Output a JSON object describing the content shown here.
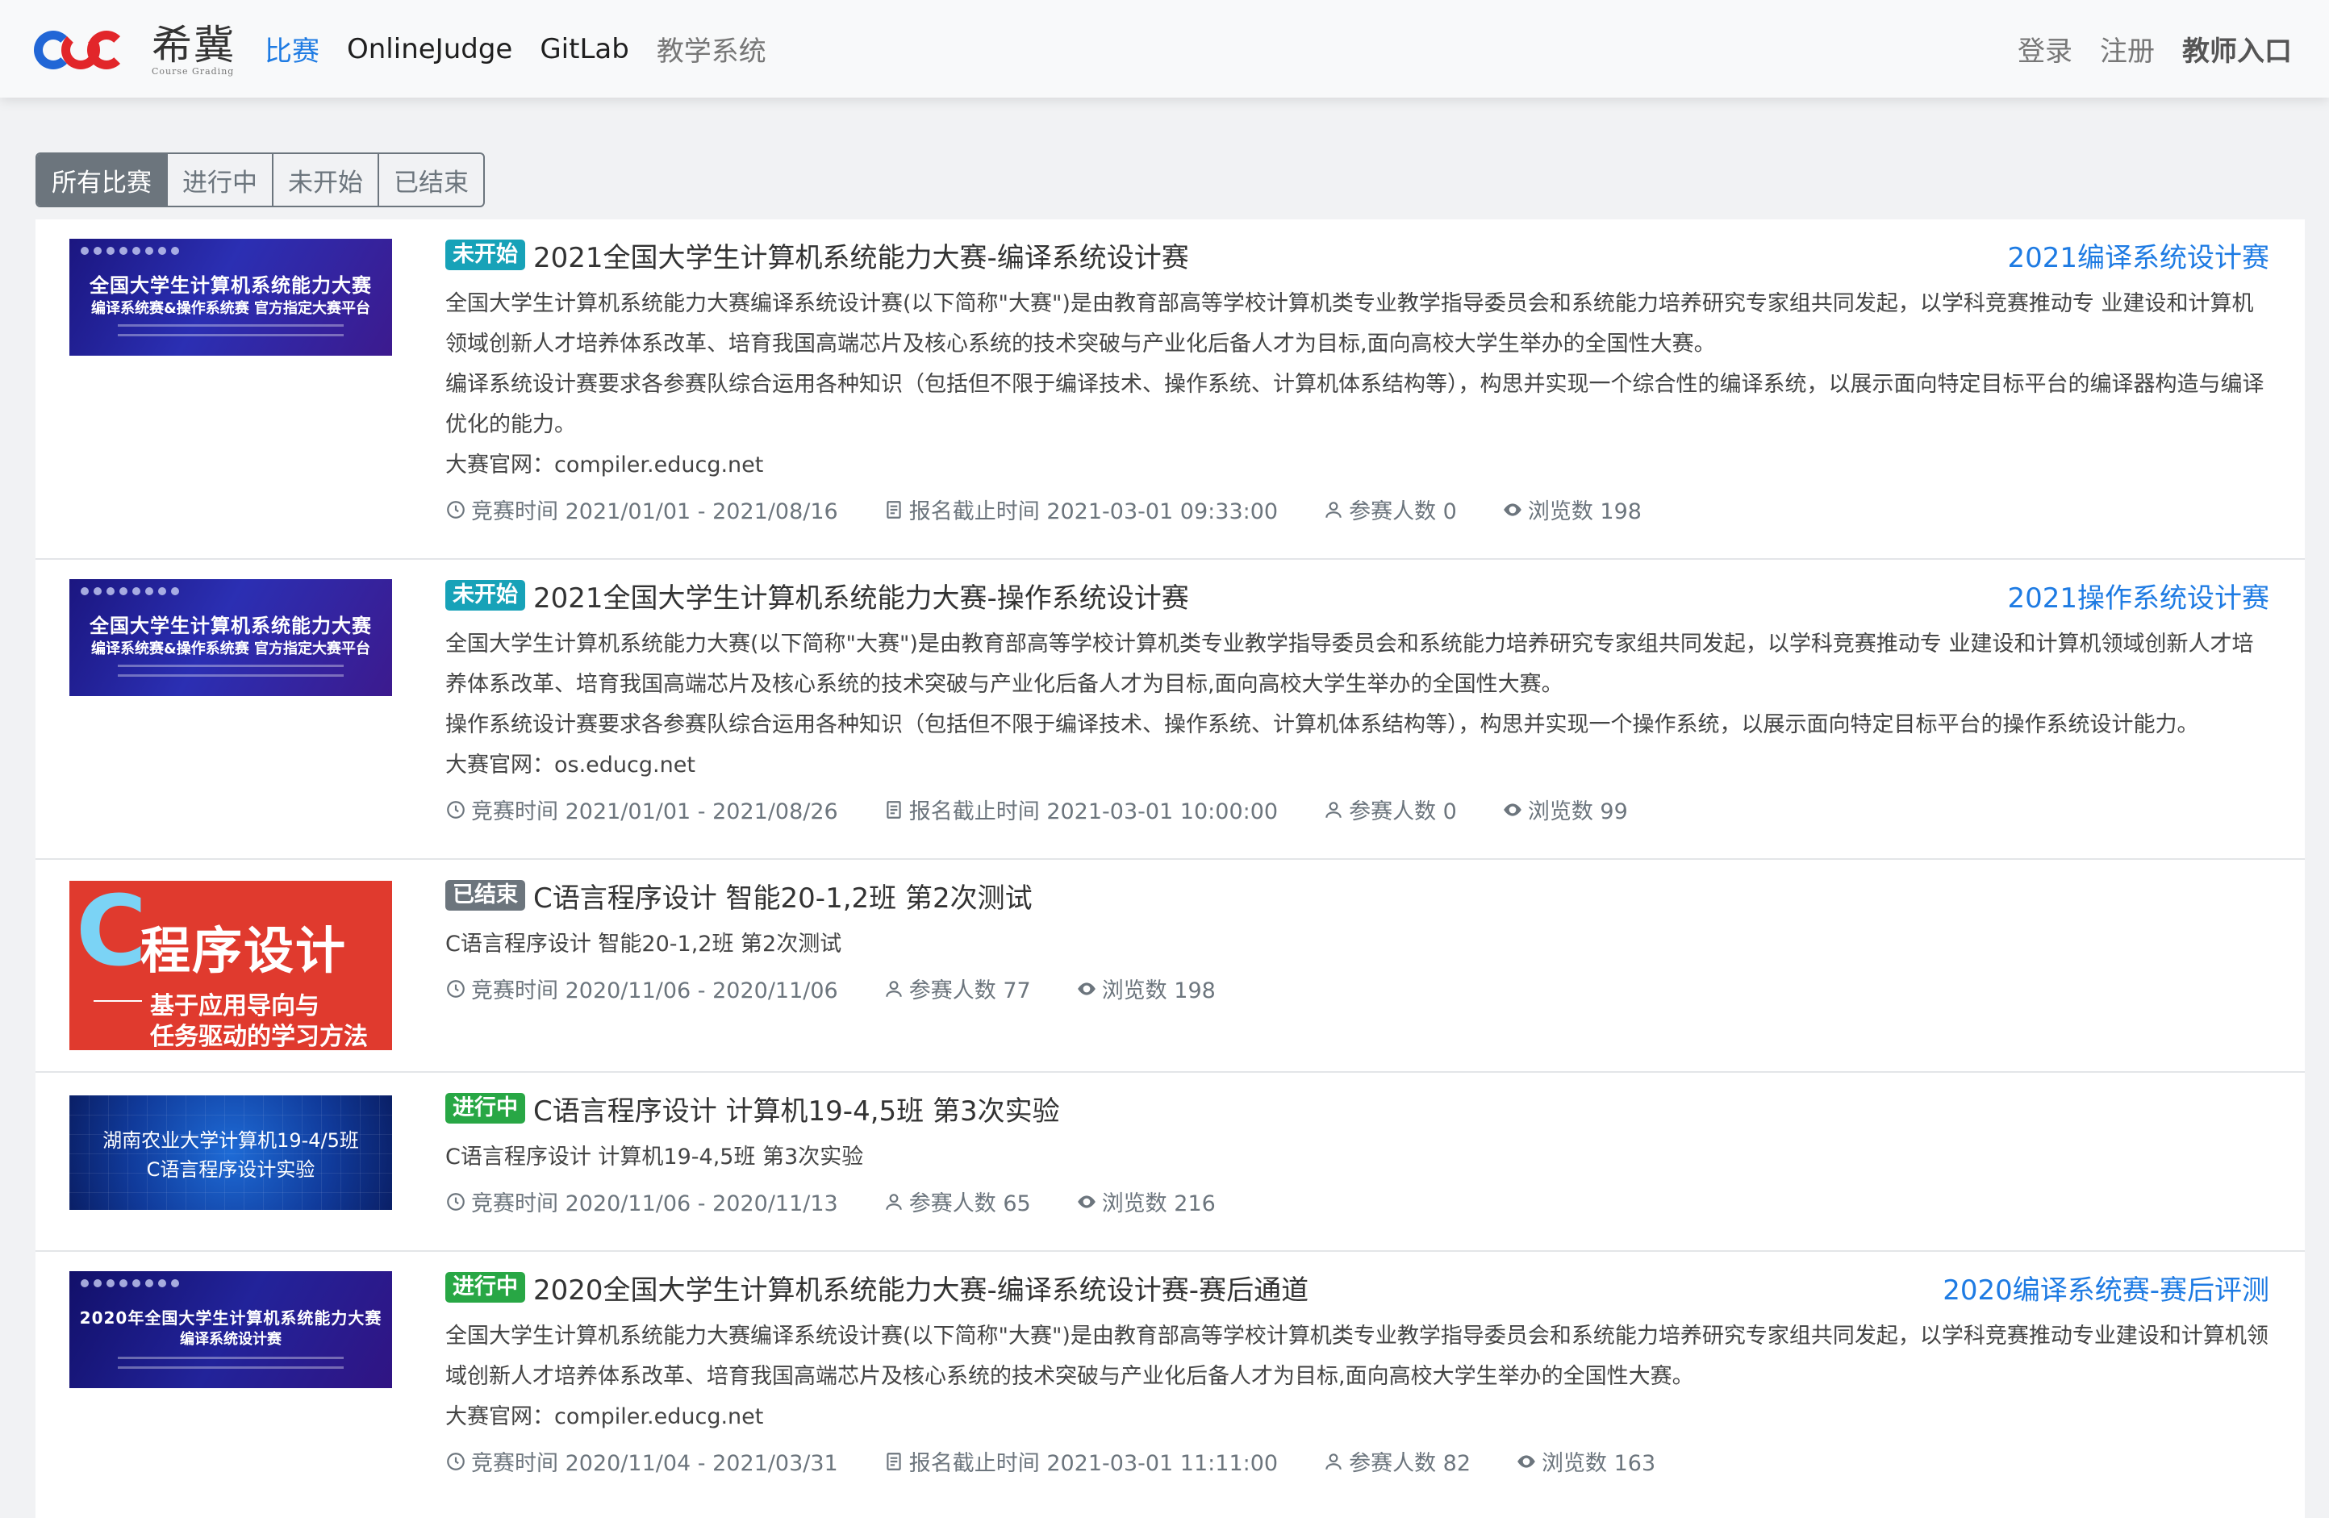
{
  "brand": {
    "name": "希冀",
    "sub": "Course Grading"
  },
  "nav": {
    "left": [
      {
        "label": "比赛",
        "state": "active"
      },
      {
        "label": "OnlineJudge",
        "state": "normal"
      },
      {
        "label": "GitLab",
        "state": "normal"
      },
      {
        "label": "教学系统",
        "state": "muted"
      }
    ],
    "right": [
      {
        "label": "登录"
      },
      {
        "label": "注册"
      },
      {
        "label": "教师入口"
      }
    ]
  },
  "filters": [
    "所有比赛",
    "进行中",
    "未开始",
    "已结束"
  ],
  "filter_active": "所有比赛",
  "colors": {
    "link": "#1e7be3",
    "upcoming": "#17a2b8",
    "running": "#28a745",
    "ended": "#6c757d"
  },
  "contests": [
    {
      "status": "未开始",
      "title": "2021全国大学生计算机系统能力大赛-编译系统设计赛",
      "side_link": "2021编译系统设计赛",
      "thumb": {
        "line1": "全国大学生计算机系统能力大赛",
        "line2": "编译系统赛&操作系统赛 官方指定大赛平台"
      },
      "desc": [
        "全国大学生计算机系统能力大赛编译系统设计赛(以下简称\"大赛\")是由教育部高等学校计算机类专业教学指导委员会和系统能力培养研究专家组共同发起，以学科竞赛推动专 业建设和计算机领域创新人才培养体系改革、培育我国高端芯片及核心系统的技术突破与产业化后备人才为目标,面向高校大学生举办的全国性大赛。",
        "编译系统设计赛要求各参赛队综合运用各种知识（包括但不限于编译技术、操作系统、计算机体系结构等），构思并实现一个综合性的编译系统，以展示面向特定目标平台的编译器构造与编译优化的能力。",
        "大赛官网：compiler.educg.net"
      ],
      "time": "竞赛时间 2021/01/01 - 2021/08/16",
      "deadline": "报名截止时间 2021-03-01 09:33:00",
      "participants": "参赛人数 0",
      "views": "浏览数 198"
    },
    {
      "status": "未开始",
      "title": "2021全国大学生计算机系统能力大赛-操作系统设计赛",
      "side_link": "2021操作系统设计赛",
      "thumb": {
        "line1": "全国大学生计算机系统能力大赛",
        "line2": "编译系统赛&操作系统赛 官方指定大赛平台"
      },
      "desc": [
        "全国大学生计算机系统能力大赛(以下简称\"大赛\")是由教育部高等学校计算机类专业教学指导委员会和系统能力培养研究专家组共同发起，以学科竞赛推动专 业建设和计算机领域创新人才培养体系改革、培育我国高端芯片及核心系统的技术突破与产业化后备人才为目标,面向高校大学生举办的全国性大赛。",
        "操作系统设计赛要求各参赛队综合运用各种知识（包括但不限于编译技术、操作系统、计算机体系结构等），构思并实现一个操作系统，以展示面向特定目标平台的操作系统设计能力。",
        "大赛官网：os.educg.net"
      ],
      "time": "竞赛时间 2021/01/01 - 2021/08/26",
      "deadline": "报名截止时间 2021-03-01 10:00:00",
      "participants": "参赛人数 0",
      "views": "浏览数 99"
    },
    {
      "status": "已结束",
      "title": "C语言程序设计 智能20-1,2班 第2次测试",
      "side_link": "",
      "thumb": {
        "big": "C",
        "line1": "程序设计",
        "line2": "基于应用导向与",
        "line3": "任务驱动的学习方法"
      },
      "desc": [
        "C语言程序设计 智能20-1,2班 第2次测试"
      ],
      "time": "竞赛时间 2020/11/06 - 2020/11/06",
      "deadline": "",
      "participants": "参赛人数 77",
      "views": "浏览数 198"
    },
    {
      "status": "进行中",
      "title": "C语言程序设计 计算机19-4,5班 第3次实验",
      "side_link": "",
      "thumb": {
        "line1": "湖南农业大学计算机19-4/5班",
        "line2": "C语言程序设计实验"
      },
      "desc": [
        "C语言程序设计 计算机19-4,5班 第3次实验"
      ],
      "time": "竞赛时间 2020/11/06 - 2020/11/13",
      "deadline": "",
      "participants": "参赛人数 65",
      "views": "浏览数 216"
    },
    {
      "status": "进行中",
      "title": "2020全国大学生计算机系统能力大赛-编译系统设计赛-赛后通道",
      "side_link": "2020编译系统赛-赛后评测",
      "thumb": {
        "line1": "2020年全国大学生计算机系统能力大赛",
        "line2": "编译系统设计赛"
      },
      "desc": [
        "全国大学生计算机系统能力大赛编译系统设计赛(以下简称\"大赛\")是由教育部高等学校计算机类专业教学指导委员会和系统能力培养研究专家组共同发起，以学科竞赛推动专业建设和计算机领域创新人才培养体系改革、培育我国高端芯片及核心系统的技术突破与产业化后备人才为目标,面向高校大学生举办的全国性大赛。",
        "大赛官网：compiler.educg.net"
      ],
      "time": "竞赛时间 2020/11/04 - 2021/03/31",
      "deadline": "报名截止时间 2021-03-01 11:11:00",
      "participants": "参赛人数 82",
      "views": "浏览数 163"
    }
  ]
}
